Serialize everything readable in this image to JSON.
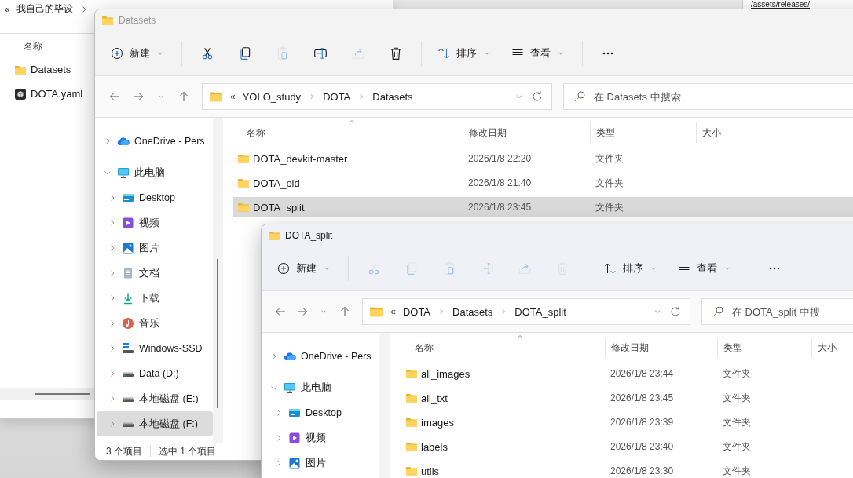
{
  "background_page_text": "/assets/releases/",
  "background_window": {
    "path_overflow": "«",
    "breadcrumb": [
      "我自己的毕设"
    ],
    "column_header": "名称",
    "files": [
      {
        "name": "Datasets",
        "kind": "folder"
      },
      {
        "name": "DOTA.yaml",
        "kind": "yaml"
      }
    ]
  },
  "windows": [
    {
      "title": "Datasets",
      "active": false,
      "toolbar": {
        "new": "新建",
        "actions": [
          {
            "kind": "cut",
            "disabled": false
          },
          {
            "kind": "copy",
            "disabled": false
          },
          {
            "kind": "paste",
            "disabled": true
          },
          {
            "kind": "rename",
            "disabled": false
          },
          {
            "kind": "share",
            "disabled": true
          },
          {
            "kind": "delete",
            "disabled": false
          }
        ],
        "sort": "排序",
        "view": "查看"
      },
      "address": {
        "path_overflow": "«",
        "path": [
          "YOLO_study",
          "DOTA",
          "Datasets"
        ]
      },
      "search": {
        "placeholder": "在 Datasets 中搜索"
      },
      "nav": [
        {
          "label": "OneDrive - Pers",
          "kind": "cloud",
          "expanded": false,
          "selected": false
        },
        {
          "label": "此电脑",
          "kind": "computer",
          "expanded": true,
          "selected": false,
          "children": [
            {
              "label": "Desktop",
              "kind": "desktop",
              "expanded": false,
              "selected": false
            },
            {
              "label": "视频",
              "kind": "videos",
              "expanded": false,
              "selected": false
            },
            {
              "label": "图片",
              "kind": "pictures",
              "expanded": false,
              "selected": false
            },
            {
              "label": "文档",
              "kind": "documents",
              "expanded": false,
              "selected": false
            },
            {
              "label": "下载",
              "kind": "downloads",
              "expanded": false,
              "selected": false
            },
            {
              "label": "音乐",
              "kind": "music",
              "expanded": false,
              "selected": false
            },
            {
              "label": "Windows-SSD",
              "kind": "system_drive",
              "expanded": false,
              "selected": false
            },
            {
              "label": "Data (D:)",
              "kind": "drive",
              "expanded": false,
              "selected": false
            },
            {
              "label": "本地磁盘 (E:)",
              "kind": "drive",
              "expanded": false,
              "selected": false
            },
            {
              "label": "本地磁盘 (F:)",
              "kind": "drive",
              "expanded": false,
              "selected": true
            }
          ]
        }
      ],
      "columns": [
        "名称",
        "修改日期",
        "类型",
        "大小"
      ],
      "files": [
        {
          "name": "DOTA_devkit-master",
          "modified": "2026/1/8 22:20",
          "type": "文件夹",
          "selected": false
        },
        {
          "name": "DOTA_old",
          "modified": "2026/1/8 21:40",
          "type": "文件夹",
          "selected": false
        },
        {
          "name": "DOTA_split",
          "modified": "2026/1/8 23:45",
          "type": "文件夹",
          "selected": true
        }
      ],
      "status_bar": [
        "3 个项目",
        "选中 1 个项目"
      ]
    },
    {
      "title": "DOTA_split",
      "active": true,
      "toolbar": {
        "new": "新建",
        "actions": [
          {
            "kind": "cut",
            "disabled": true
          },
          {
            "kind": "copy",
            "disabled": true
          },
          {
            "kind": "paste",
            "disabled": true
          },
          {
            "kind": "rename",
            "disabled": true
          },
          {
            "kind": "share",
            "disabled": true
          },
          {
            "kind": "delete",
            "disabled": true
          }
        ],
        "sort": "排序",
        "view": "查看"
      },
      "address": {
        "path_overflow": "«",
        "path": [
          "DOTA",
          "Datasets",
          "DOTA_split"
        ]
      },
      "search": {
        "placeholder": "在 DOTA_split 中搜"
      },
      "nav": [
        {
          "label": "OneDrive - Pers",
          "kind": "cloud",
          "expanded": false,
          "selected": false
        },
        {
          "label": "此电脑",
          "kind": "computer",
          "expanded": true,
          "selected": false,
          "children": [
            {
              "label": "Desktop",
              "kind": "desktop",
              "expanded": false,
              "selected": false
            },
            {
              "label": "视频",
              "kind": "videos",
              "expanded": false,
              "selected": false
            },
            {
              "label": "图片",
              "kind": "pictures",
              "expanded": false,
              "selected": false
            }
          ]
        }
      ],
      "columns": [
        "名称",
        "修改日期",
        "类型",
        "大小"
      ],
      "files": [
        {
          "name": "all_images",
          "modified": "2026/1/8 23:44",
          "type": "文件夹",
          "selected": false
        },
        {
          "name": "all_txt",
          "modified": "2026/1/8 23:45",
          "type": "文件夹",
          "selected": false
        },
        {
          "name": "images",
          "modified": "2026/1/8 23:39",
          "type": "文件夹",
          "selected": false
        },
        {
          "name": "labels",
          "modified": "2026/1/8 23:40",
          "type": "文件夹",
          "selected": false
        },
        {
          "name": "utils",
          "modified": "2026/1/8 23:30",
          "type": "文件夹",
          "selected": false
        }
      ]
    }
  ]
}
